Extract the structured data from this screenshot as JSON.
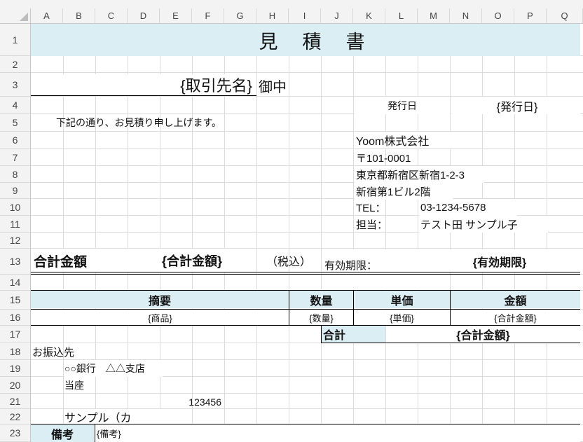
{
  "columns": [
    "A",
    "B",
    "C",
    "D",
    "E",
    "F",
    "G",
    "H",
    "I",
    "J",
    "K",
    "L",
    "M",
    "N",
    "O",
    "P",
    "Q"
  ],
  "rows": [
    "1",
    "2",
    "3",
    "4",
    "5",
    "6",
    "7",
    "8",
    "9",
    "10",
    "11",
    "12",
    "13",
    "14",
    "15",
    "16",
    "17",
    "18",
    "19",
    "20",
    "21",
    "22",
    "23"
  ],
  "doc": {
    "title": "見　積　書",
    "client_placeholder": "{取引先名}",
    "honorific": "御中",
    "issue_date_label": "発行日",
    "issue_date_value": "{発行日}",
    "greeting": "下記の通り、お見積り申し上げます。",
    "company": "Yoom株式会社",
    "postal": "〒101-0001",
    "address1": "東京都新宿区新宿1-2-3",
    "address2": "新宿第1ビル2階",
    "tel_label": "TEL：",
    "tel_value": "03-1234-5678",
    "person_label": "担当：",
    "person_value": "テスト田 サンプル子",
    "total_label": "合計金額",
    "total_value": "{合計金額}",
    "tax_note": "（税込）",
    "validity_label": "有効期限：",
    "validity_value": "{有効期限}"
  },
  "table": {
    "headers": {
      "summary": "摘要",
      "qty": "数量",
      "unit_price": "単価",
      "amount": "金額"
    },
    "row": {
      "summary": "{商品}",
      "qty": "{数量}",
      "unit_price": "{単価}",
      "amount": "{合計金額}"
    },
    "sum_label": "合計",
    "sum_value": "{合計金額}"
  },
  "bank": {
    "heading": "お振込先",
    "bank_name": "○○銀行　△△支店",
    "account_type": "当座",
    "account_number": "123456",
    "holder": "サンプル（カ"
  },
  "remarks": {
    "label": "備考",
    "value": "{備考}"
  },
  "colors": {
    "header_fill": "#dbeef4",
    "grid": "#dcdcdc"
  }
}
